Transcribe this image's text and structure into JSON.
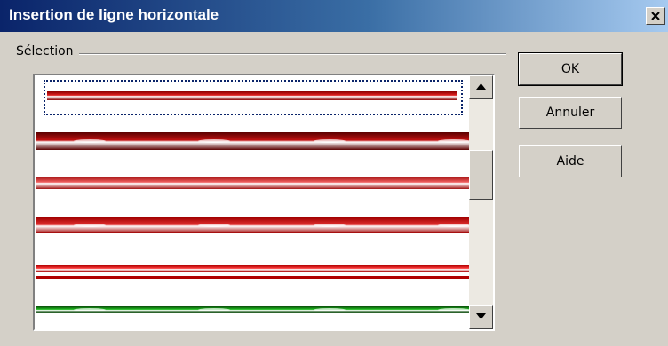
{
  "window": {
    "title": "Insertion de ligne horizontale",
    "close_icon": "close-icon"
  },
  "selection": {
    "group_label": "Sélection",
    "items": [
      {
        "style": "red-gradient",
        "colors": [
          "#8b0000",
          "#e02020",
          "#ffffff"
        ],
        "selected": true
      },
      {
        "style": "red-sparkle",
        "colors": [
          "#5a0000",
          "#c01010",
          "#ffffff"
        ]
      },
      {
        "style": "red-gradient-soft",
        "colors": [
          "#a01010",
          "#f06060",
          "#ffffff"
        ]
      },
      {
        "style": "red-flare",
        "colors": [
          "#a00000",
          "#e03030",
          "#ffffff"
        ]
      },
      {
        "style": "red-double-thin",
        "colors": [
          "#b00000",
          "#ff4040",
          "#ffffff"
        ]
      },
      {
        "style": "green-sparkle",
        "colors": [
          "#0a4a0a",
          "#20c020",
          "#ffffff"
        ]
      }
    ]
  },
  "buttons": {
    "ok": "OK",
    "cancel": "Annuler",
    "help": "Aide"
  }
}
